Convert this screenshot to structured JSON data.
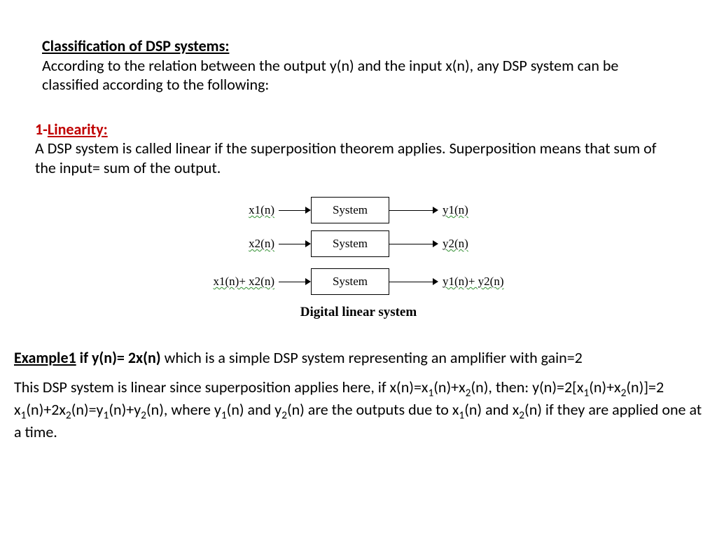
{
  "title": "Classification of DSP systems:",
  "intro": "According to the relation between the output y(n)  and the input x(n), any DSP system can be classified according to the following:",
  "linearity": {
    "num": "1-",
    "name": "Linearity:",
    "desc": "A DSP system is called linear if the superposition theorem applies. Superposition means that sum of the input= sum of the output."
  },
  "diagram": {
    "rows": [
      {
        "in": "x1(n)",
        "box": "System",
        "out": "y1(n)"
      },
      {
        "in": "x2(n)",
        "box": "System",
        "out": "y2(n)"
      },
      {
        "in": "x1(n)+ x2(n)",
        "box": "System",
        "out": "y1(n)+ y2(n)"
      }
    ],
    "caption": "Digital linear system"
  },
  "example": {
    "label": "Example1",
    "cond": " if  y(n)= 2x(n)",
    "tail": " which is a simple DSP system representing an amplifier with gain=2",
    "body_html": "This DSP system is linear since superposition applies here, if x(n)=x<sub>1</sub>(n)+x<sub>2</sub>(n), then: y(n)=2[x<sub>1</sub>(n)+x<sub>2</sub>(n)]=2 x<sub>1</sub>(n)+2x<sub>2</sub>(n)=y<sub>1</sub>(n)+y<sub>2</sub>(n), where y<sub>1</sub>(n) and y<sub>2</sub>(n) are the outputs due to x<sub>1</sub>(n) and x<sub>2</sub>(n) if they are applied one at a time."
  }
}
